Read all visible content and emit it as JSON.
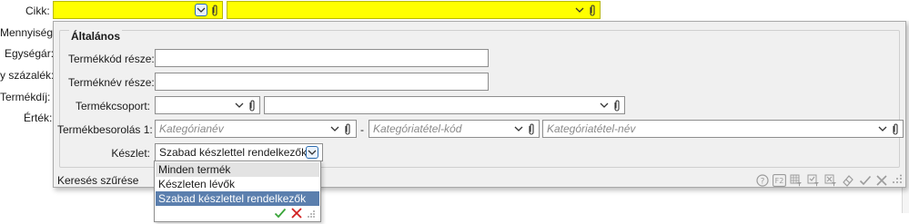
{
  "background_labels": {
    "mennyiseg": "Mennyiség:",
    "egysegar": "Egységár:",
    "szazalek": "y százalék:",
    "termekdij": "Termékdíj:",
    "ertek": "Érték:"
  },
  "cikk": {
    "label": "Cikk:",
    "code_value": "",
    "name_value": "",
    "highlight_color": "#ffff00"
  },
  "panel": {
    "group_title": "Általános",
    "fields": {
      "termekkod": {
        "label": "Termékkód része:",
        "value": ""
      },
      "termeknev": {
        "label": "Terméknév része:",
        "value": ""
      },
      "termekcsoport": {
        "label": "Termékcsoport:",
        "code_value": "",
        "name_value": ""
      },
      "besorolas": {
        "label": "Termékbesorolás 1:",
        "kategorianev_placeholder": "Kategórianév",
        "separator": "-",
        "tetelkod_placeholder": "Kategóriatétel-kód",
        "tetelnev_placeholder": "Kategóriatétel-név"
      },
      "keszlet": {
        "label": "Készlet:",
        "value": "Szabad készlettel rendelkezők"
      }
    },
    "filter_label": "Keresés szűrése",
    "toolbar_icons": [
      "help-icon",
      "f2-key-icon",
      "filter-grid-icon",
      "filter-check-icon",
      "filter-clear-icon",
      "eraser-icon",
      "ok-icon",
      "cancel-icon",
      "more-icon"
    ]
  },
  "keszlet_dropdown": {
    "options": [
      "Minden termék",
      "Készleten lévők",
      "Szabad készlettel rendelkezők"
    ],
    "hovered_index": 0,
    "selected_index": 2,
    "accept_color": "#3aa53a",
    "reject_color": "#d02020"
  }
}
